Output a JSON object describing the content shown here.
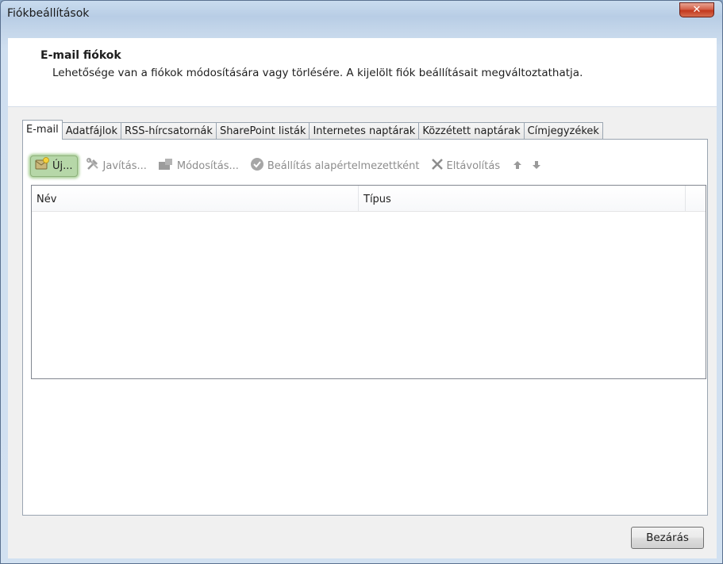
{
  "window": {
    "title": "Fiókbeállítások",
    "close_icon": "x-icon"
  },
  "header": {
    "title": "E-mail fiókok",
    "description": "Lehetősége van a fiókok módosítására vagy törlésére. A kijelölt fiók beállításait megváltoztathatja."
  },
  "tabs": [
    {
      "label": "E-mail",
      "active": true
    },
    {
      "label": "Adatfájlok",
      "active": false
    },
    {
      "label": "RSS-hírcsatornák",
      "active": false
    },
    {
      "label": "SharePoint listák",
      "active": false
    },
    {
      "label": "Internetes naptárak",
      "active": false
    },
    {
      "label": "Közzétett naptárak",
      "active": false
    },
    {
      "label": "Címjegyzékek",
      "active": false
    }
  ],
  "toolbar": {
    "new_label": "Új...",
    "repair_label": "Javítás...",
    "change_label": "Módosítás...",
    "set_default_label": "Beállítás alapértelmezettként",
    "remove_label": "Eltávolítás",
    "move_up_icon": "arrow-up-icon",
    "move_down_icon": "arrow-down-icon"
  },
  "grid": {
    "columns": [
      "Név",
      "Típus"
    ],
    "rows": []
  },
  "footer": {
    "close_label": "Bezárás"
  },
  "colors": {
    "highlight_green": "#b6d7a8",
    "close_red": "#c2381e"
  }
}
